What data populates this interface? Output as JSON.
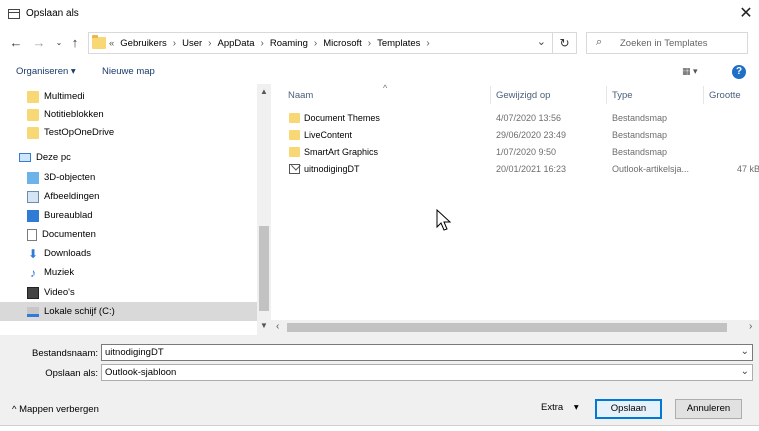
{
  "window": {
    "title": "Opslaan als"
  },
  "address": {
    "lead": "«",
    "crumbs": [
      "Gebruikers",
      "User",
      "AppData",
      "Roaming",
      "Microsoft",
      "Templates"
    ],
    "search_placeholder": "Zoeken in Templates"
  },
  "toolbar": {
    "organize_label": "Organiseren ▾",
    "new_folder_label": "Nieuwe map",
    "help_label": "?"
  },
  "nav_pane": {
    "items": [
      {
        "label": "Multimedi",
        "icon": "folder-icon"
      },
      {
        "label": "Notitieblokken",
        "icon": "folder-icon"
      },
      {
        "label": "TestOpOneDrive",
        "icon": "folder-icon"
      },
      {
        "label": "Deze pc",
        "icon": "computer-icon"
      },
      {
        "label": "3D-objecten",
        "icon": "3d-objects-icon"
      },
      {
        "label": "Afbeeldingen",
        "icon": "pictures-icon"
      },
      {
        "label": "Bureaublad",
        "icon": "desktop-icon"
      },
      {
        "label": "Documenten",
        "icon": "documents-icon"
      },
      {
        "label": "Downloads",
        "icon": "downloads-icon"
      },
      {
        "label": "Muziek",
        "icon": "music-icon"
      },
      {
        "label": "Video's",
        "icon": "videos-icon"
      },
      {
        "label": "Lokale schijf (C:)",
        "icon": "drive-icon"
      }
    ]
  },
  "file_list": {
    "columns": {
      "name": "Naam",
      "modified": "Gewijzigd op",
      "type": "Type",
      "size": "Grootte"
    },
    "rows": [
      {
        "name": "Document Themes",
        "modified": "4/07/2020 13:56",
        "type": "Bestandsmap",
        "size": "",
        "icon": "folder-icon"
      },
      {
        "name": "LiveContent",
        "modified": "29/06/2020 23:49",
        "type": "Bestandsmap",
        "size": "",
        "icon": "folder-icon"
      },
      {
        "name": "SmartArt Graphics",
        "modified": "1/07/2020 9:50",
        "type": "Bestandsmap",
        "size": "",
        "icon": "folder-icon"
      },
      {
        "name": "uitnodigingDT",
        "modified": "20/01/2021 16:23",
        "type": "Outlook-artikelsja...",
        "size": "47 kB",
        "icon": "outlook-template-icon"
      }
    ]
  },
  "form": {
    "filename_label": "Bestandsnaam:",
    "filename_value": "uitnodigingDT",
    "savetype_label": "Opslaan als:",
    "savetype_value": "Outlook-sjabloon",
    "hide_folders_label": "Mappen verbergen",
    "extra_label": "Extra",
    "save_label": "Opslaan",
    "cancel_label": "Annuleren"
  }
}
